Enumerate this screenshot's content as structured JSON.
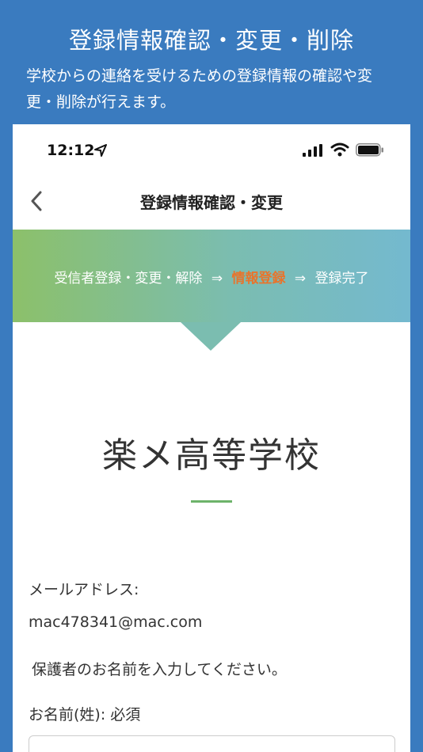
{
  "promo": {
    "title": "登録情報確認・変更・削除",
    "subtitle": "学校からの連絡を受けるための登録情報の確認や変更・削除が行えます。"
  },
  "status_bar": {
    "time": "12:12",
    "icons": [
      "location-arrow-icon",
      "cellular-signal-icon",
      "wifi-icon",
      "battery-icon"
    ]
  },
  "nav": {
    "title": "登録情報確認・変更",
    "back_icon": "chevron-left-icon"
  },
  "steps": {
    "items": [
      "受信者登録・変更・解除",
      "情報登録",
      "登録完了"
    ],
    "separator": "⇒",
    "active_index": 1,
    "active_color": "#e8742c"
  },
  "school": {
    "name": "楽メ高等学校",
    "accent_color": "#6db36a"
  },
  "form": {
    "email_label": "メールアドレス:",
    "email_value": "mac478341@mac.com",
    "instruction": "保護者のお名前を入力してください。",
    "lastname_label": "お名前(姓): 必須",
    "lastname_value": ""
  },
  "colors": {
    "background": "#3a7bbf",
    "banner_start": "#8cc06a",
    "banner_end": "#74b9cf"
  }
}
